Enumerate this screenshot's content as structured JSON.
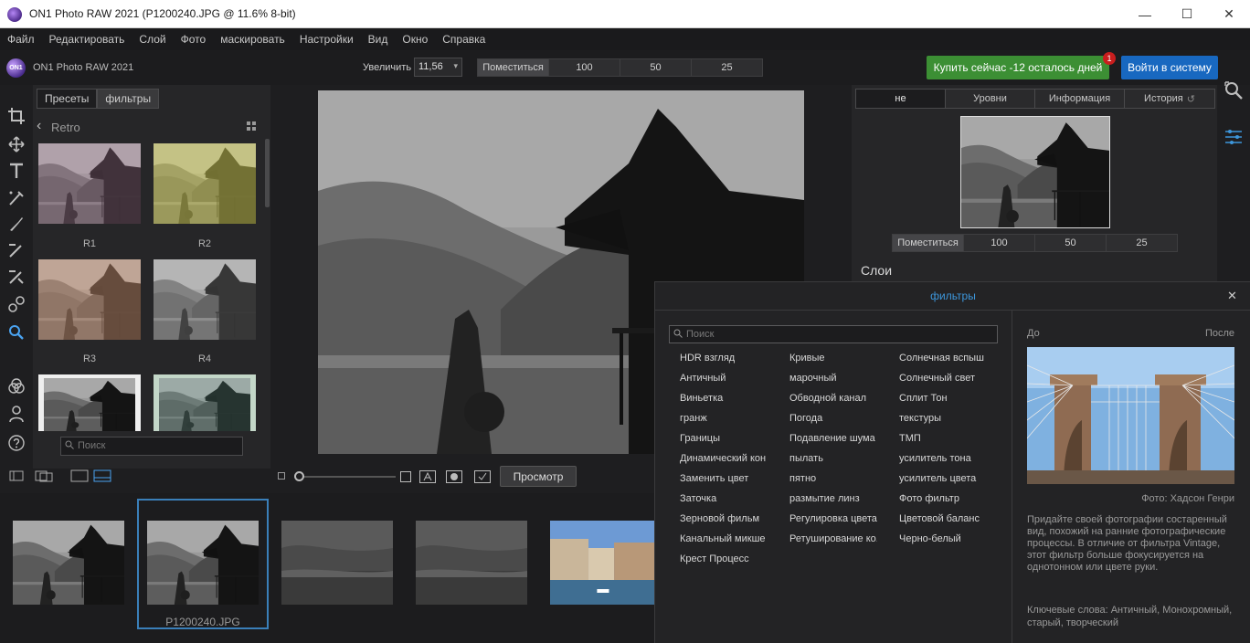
{
  "window": {
    "title": "ON1 Photo RAW 2021 (P1200240.JPG @ 11.6% 8-bit)",
    "minimize_glyph": "—",
    "maximize_glyph": "☐",
    "close_glyph": "✕"
  },
  "menu": [
    "Файл",
    "Редактировать",
    "Слой",
    "Фото",
    "маскировать",
    "Настройки",
    "Вид",
    "Окно",
    "Справка"
  ],
  "appbar": {
    "logo_text": "ON1",
    "app_name": "ON1 Photo RAW 2021",
    "zoom_label": "Увеличить",
    "zoom_value": "11,56",
    "view_modes": [
      "Поместиться",
      "100",
      "50",
      "25"
    ],
    "buy_label": "Купить сейчас -12 осталось дней",
    "buy_badge": "1",
    "login_label": "Войти в систему",
    "buy_color": "#3c8f34",
    "login_color": "#1868c0"
  },
  "left_panel": {
    "tabs": [
      "Пресеты",
      "фильтры"
    ],
    "category": "Retro",
    "presets": [
      "R1",
      "R2",
      "R3",
      "R4"
    ],
    "search_placeholder": "Поиск"
  },
  "preview": {
    "button_label": "Просмотр"
  },
  "filmstrip": {
    "selected_name": "P1200240.JPG",
    "selected_color": "#3a7fb9"
  },
  "right_panel": {
    "tabs": [
      "не",
      "Уровни",
      "Информация",
      "История"
    ],
    "view_modes": [
      "Поместиться",
      "100",
      "50",
      "25"
    ],
    "layers_title": "Слои"
  },
  "filters_dialog": {
    "title": "фильтры",
    "close_glyph": "✕",
    "search_placeholder": "Поиск",
    "columns": [
      [
        "HDR взгляд",
        "Античный",
        "Виньетка",
        "гранж",
        "Границы",
        "Динамический кон",
        "Заменить цвет",
        "Заточка",
        "Зерновой фильм",
        "Канальный микше",
        "Крест Процесс"
      ],
      [
        "Кривые",
        "марочный",
        "Обводной канал",
        "Погода",
        "Подавление шума",
        "пылать",
        "пятно",
        "размытие линз",
        "Регулировка цвета",
        "Ретуширование ко."
      ],
      [
        "Солнечная вспыш",
        "Солнечный свет",
        "Сплит Тон",
        "текстуры",
        "ТМП",
        "усилитель тона",
        "усилитель цвета",
        "Фото фильтр",
        "Цветовой баланс",
        "Черно-белый"
      ]
    ],
    "before_label": "До",
    "after_label": "После",
    "photo_credit": "Фото: Хадсон Генри",
    "description": "Придайте своей фотографии состаренный вид, похожий на ранние фотографические процессы. В отличие от фильтра Vintage, этот фильтр больше фокусируется на однотонном или цвете руки.",
    "keywords": "Ключевые слова: Античный, Монохромный, старый, творческий",
    "title_color": "#3d96db"
  }
}
